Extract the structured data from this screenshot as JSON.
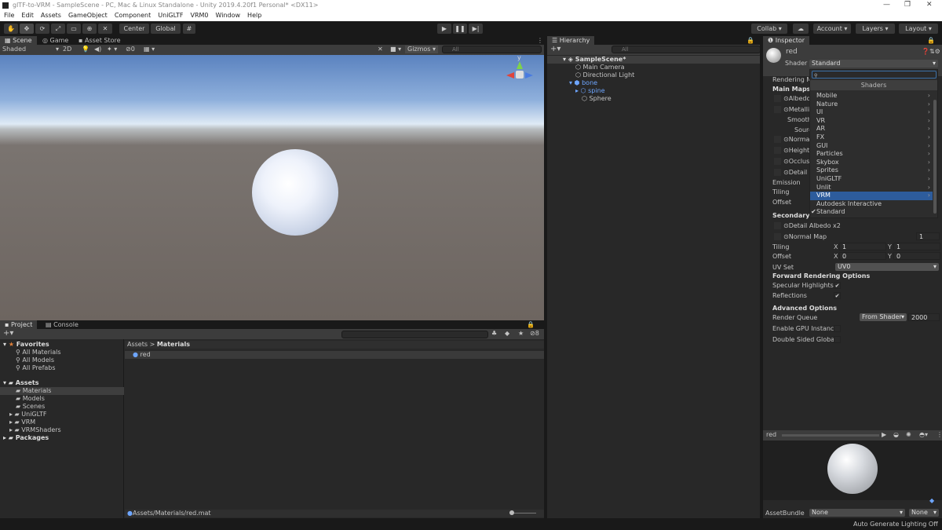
{
  "window": {
    "title": "glTF-to-VRM - SampleScene - PC, Mac & Linux Standalone - Unity 2019.4.20f1 Personal* <DX11>"
  },
  "menu": [
    "File",
    "Edit",
    "Assets",
    "GameObject",
    "Component",
    "UniGLTF",
    "VRM0",
    "Window",
    "Help"
  ],
  "toolbar": {
    "pivot": "Center",
    "space": "Global",
    "collab": "Collab",
    "account": "Account",
    "layers": "Layers",
    "layout": "Layout"
  },
  "scene": {
    "tabs": [
      "Scene",
      "Game",
      "Asset Store"
    ],
    "shading": "Shaded",
    "mode_2d": "2D",
    "hidden_count": "0",
    "gizmos": "Gizmos",
    "search_placeholder": "All",
    "gizmo_label": "y"
  },
  "hierarchy": {
    "tab": "Hierarchy",
    "search_placeholder": "All",
    "items": [
      {
        "label": "SampleScene*"
      },
      {
        "label": "Main Camera"
      },
      {
        "label": "Directional Light"
      },
      {
        "label": "bone"
      },
      {
        "label": "spine"
      },
      {
        "label": "Sphere"
      }
    ]
  },
  "project": {
    "tabs": [
      "Project",
      "Console"
    ],
    "favorites": {
      "label": "Favorites",
      "items": [
        "All Materials",
        "All Models",
        "All Prefabs"
      ]
    },
    "assets": {
      "label": "Assets",
      "items": [
        "Materials",
        "Models",
        "Scenes",
        "UniGLTF",
        "VRM",
        "VRMShaders"
      ]
    },
    "packages": "Packages",
    "breadcrumb": [
      "Assets",
      "Materials"
    ],
    "files": [
      "red"
    ],
    "hidden_count": "8",
    "path": "Assets/Materials/red.mat"
  },
  "inspector": {
    "tab": "Inspector",
    "name": "red",
    "shader_label": "Shader",
    "shader_value": "Standard",
    "labels_left": [
      "Rendering Mo",
      "Main Maps",
      "Albedo",
      "Metallic",
      "Smooth",
      "Sourc",
      "Normal I",
      "Height M",
      "Occlusi",
      "Detail M",
      "Emission",
      "Tiling",
      "Offset",
      "Secondary M"
    ],
    "detail_albedo": "Detail Albedo x2",
    "normal_map": "Normal Map",
    "normal_scale": "1",
    "tiling_label": "Tiling",
    "offset_label": "Offset",
    "x": "X",
    "y": "Y",
    "tiling_x": "1",
    "tiling_y": "1",
    "offset_x": "0",
    "offset_y": "0",
    "uv_set_label": "UV Set",
    "uv_set": "UV0",
    "forward_header": "Forward Rendering Options",
    "specular": "Specular Highlights",
    "reflections": "Reflections",
    "advanced_header": "Advanced Options",
    "render_queue_label": "Render Queue",
    "render_queue_mode": "From Shader",
    "render_queue": "2000",
    "gpu_instancing": "Enable GPU Instancing",
    "double_sided": "Double Sided Global Il",
    "preview_name": "red",
    "assetbundle_label": "AssetBundle",
    "assetbundle": "None",
    "assetbundle_variant": "None"
  },
  "shader_menu": {
    "header": "Shaders",
    "items": [
      {
        "label": "Mobile",
        "sub": true
      },
      {
        "label": "Nature",
        "sub": true
      },
      {
        "label": "UI",
        "sub": true
      },
      {
        "label": "VR",
        "sub": true
      },
      {
        "label": "AR",
        "sub": true
      },
      {
        "label": "FX",
        "sub": true
      },
      {
        "label": "GUI",
        "sub": true
      },
      {
        "label": "Particles",
        "sub": true
      },
      {
        "label": "Skybox",
        "sub": true
      },
      {
        "label": "Sprites",
        "sub": true
      },
      {
        "label": "UniGLTF",
        "sub": true
      },
      {
        "label": "Unlit",
        "sub": true
      },
      {
        "label": "VRM",
        "sub": true,
        "selected": true
      },
      {
        "label": "Autodesk Interactive",
        "sub": false
      },
      {
        "label": "Standard",
        "sub": false,
        "checked": true
      }
    ]
  },
  "status": {
    "text": "Auto Generate Lighting Off"
  },
  "colors": {
    "selection": "#2d5c9c",
    "link_blue": "#6ea6ff",
    "sky": "#5f86c0",
    "ground": "#6d6560"
  }
}
